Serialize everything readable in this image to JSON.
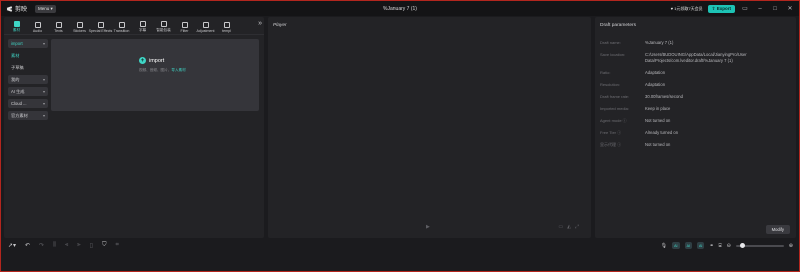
{
  "app": {
    "name": "剪映",
    "menu_label": "Menu",
    "title": "%January 7 (1)"
  },
  "titlebar": {
    "promo": "1元领取7天会员",
    "export_label": "Export",
    "minimize": "–",
    "maximize": "□",
    "close": "✕"
  },
  "tabs": [
    {
      "label": "素材",
      "icon": "media-icon",
      "active": true
    },
    {
      "label": "Audio",
      "icon": "audio-icon"
    },
    {
      "label": "Texts",
      "icon": "text-icon"
    },
    {
      "label": "Stickers",
      "icon": "sticker-icon"
    },
    {
      "label": "Special Effects",
      "icon": "effects-icon"
    },
    {
      "label": "Transition",
      "icon": "transition-icon"
    },
    {
      "label": "字幕",
      "icon": "subtitle-icon"
    },
    {
      "label": "智能包装",
      "icon": "smart-pack-icon"
    },
    {
      "label": "Filter",
      "icon": "filter-icon"
    },
    {
      "label": "Adjustment",
      "icon": "adjustment-icon"
    },
    {
      "label": "templ",
      "icon": "template-icon"
    }
  ],
  "more_tabs": "»",
  "sidebar": {
    "items": [
      {
        "label": "import",
        "pill": true,
        "active": true,
        "chevron": "▾"
      },
      {
        "label": "素材",
        "pill": false,
        "active": true
      },
      {
        "label": "子草稿",
        "pill": false
      },
      {
        "label": "我的",
        "pill": true,
        "chevron": "▾"
      },
      {
        "label": "AI 生成",
        "pill": true,
        "chevron": "▾"
      },
      {
        "label": "Cloud ...",
        "pill": true,
        "chevron": "▾"
      },
      {
        "label": "官方素材",
        "pill": true,
        "chevron": "▾"
      }
    ]
  },
  "import_card": {
    "label": "import",
    "hint_prefix": "视频、音频、图片、",
    "hint_link": "导入素材"
  },
  "player": {
    "title": "Player"
  },
  "draft": {
    "title": "Draft parameters",
    "rows": [
      {
        "key": "Draft name:",
        "value": "%January 7 (1)"
      },
      {
        "key": "Save location:",
        "value": "C:/Users/BUDOUING/AppData/Local/JianyingPro/User Data/Projects/com.lveditor.draft/%January 7 (1)"
      },
      {
        "key": "Ratio:",
        "value": "Adaptation"
      },
      {
        "key": "Resolution:",
        "value": "Adaptation"
      },
      {
        "key": "Draft frame rate:",
        "value": "30.00frames/second"
      },
      {
        "key": "Imported media:",
        "value": "Keep in place"
      },
      {
        "key": "Agent mode ⓘ",
        "value": "Not turned on"
      },
      {
        "key": "Free Tier ⓘ",
        "value": "Already turned on"
      },
      {
        "key": "显示代理 ⓘ",
        "value": "Not turned on"
      }
    ],
    "modify_label": "Modify"
  },
  "timeline": {
    "chips": [
      "AI",
      "AI",
      "AI"
    ],
    "zoom_level": 0.08
  },
  "colors": {
    "accent": "#3fd6c6",
    "border": "#b3261e"
  }
}
